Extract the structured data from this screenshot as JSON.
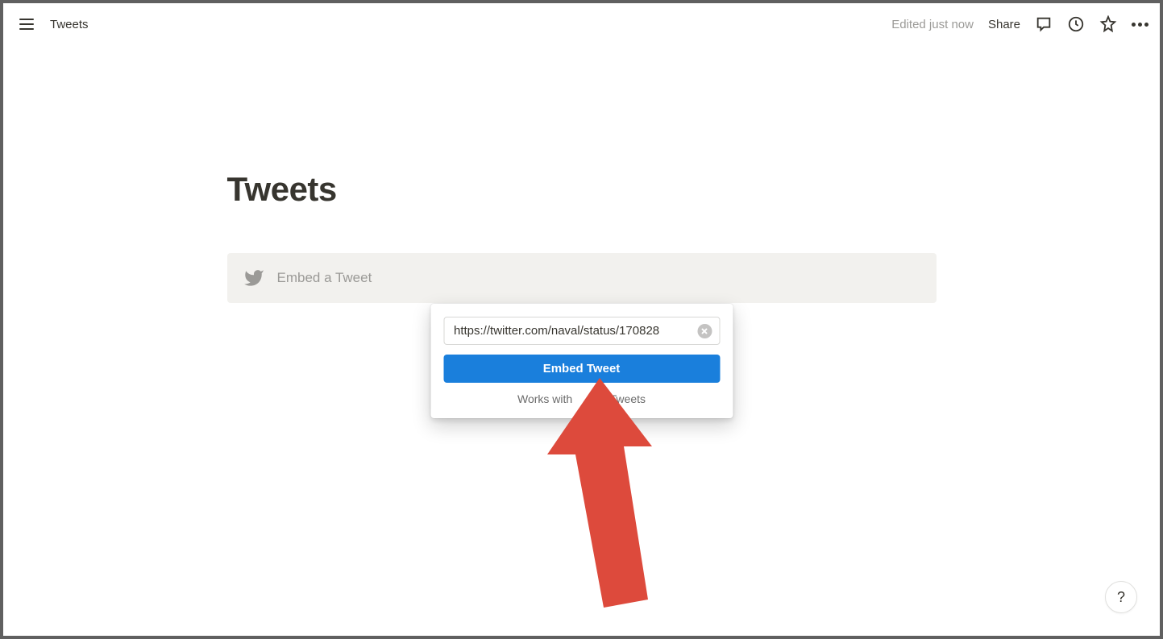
{
  "topbar": {
    "breadcrumb": "Tweets",
    "edited_status": "Edited just now",
    "share_label": "Share"
  },
  "page": {
    "title": "Tweets"
  },
  "embed_block": {
    "placeholder": "Embed a Tweet"
  },
  "popup": {
    "url_value": "https://twitter.com/naval/status/170828",
    "button_label": "Embed Tweet",
    "hint_prefix": "Works with",
    "hint_suffix": "Tweets"
  },
  "help": {
    "label": "?"
  }
}
